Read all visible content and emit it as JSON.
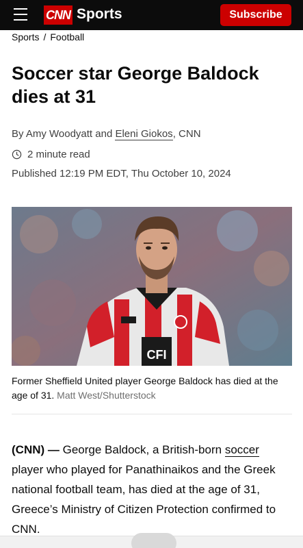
{
  "header": {
    "logo_text": "CNN",
    "section_name": "Sports",
    "subscribe_label": "Subscribe",
    "brand_color": "#cc0000"
  },
  "breadcrumb": {
    "items": [
      "Sports",
      "Football"
    ],
    "separator": "/"
  },
  "article": {
    "headline": "Soccer star George Baldock dies at 31",
    "byline_prefix": "By Amy Woodyatt and ",
    "byline_author_link": "Eleni Giokos",
    "byline_suffix": ", CNN",
    "read_time": "2 minute read",
    "published": "Published 12:19 PM EDT, Thu October 10, 2024",
    "image": {
      "icon": "soccer-player-photo"
    },
    "caption_text": "Former Sheffield United player George Baldock has died at the age of 31.",
    "caption_credit": "Matt West/Shutterstock",
    "body_lead": "(CNN) —",
    "body_part1": "George Baldock, a British-born",
    "body_link": "soccer",
    "body_part2": "player who played for Panathinaikos and the Greek national football team, has died at the age of 31, Greece’s Ministry of Citizen Protection confirmed to CNN."
  }
}
